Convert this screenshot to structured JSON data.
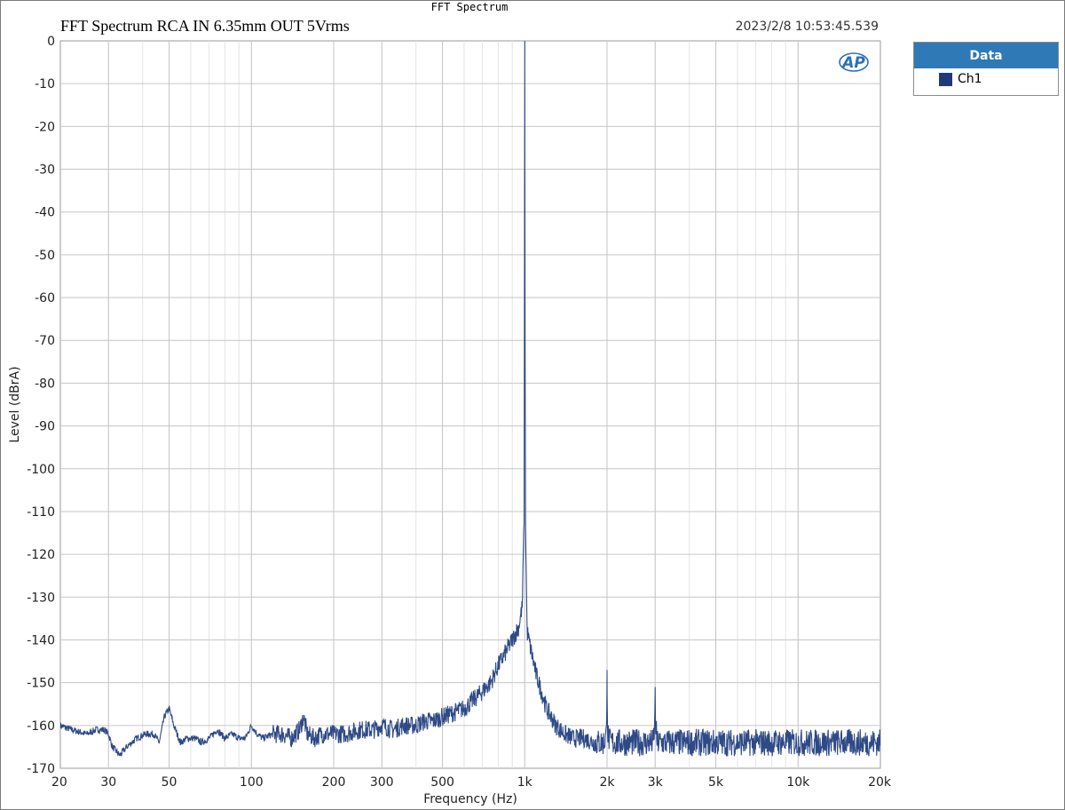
{
  "window_title": "FFT Spectrum",
  "plot_title": "FFT Spectrum RCA IN 6.35mm OUT 5Vrms",
  "timestamp": "2023/2/8 10:53:45.539",
  "logo_text": "AP",
  "legend": {
    "header": "Data",
    "items": [
      {
        "label": "Ch1",
        "color": "#1f3a78"
      }
    ]
  },
  "chart_data": {
    "type": "line",
    "xlabel": "Frequency (Hz)",
    "ylabel": "Level (dBrA)",
    "xscale": "log",
    "xlim": [
      20,
      20000
    ],
    "ylim": [
      -170,
      0
    ],
    "grid": true,
    "legend_position": "right, outside plot",
    "x_ticks": [
      {
        "value": 20,
        "label": "20"
      },
      {
        "value": 30,
        "label": "30"
      },
      {
        "value": 50,
        "label": "50"
      },
      {
        "value": 100,
        "label": "100"
      },
      {
        "value": 200,
        "label": "200"
      },
      {
        "value": 300,
        "label": "300"
      },
      {
        "value": 500,
        "label": "500"
      },
      {
        "value": 1000,
        "label": "1k"
      },
      {
        "value": 2000,
        "label": "2k"
      },
      {
        "value": 3000,
        "label": "3k"
      },
      {
        "value": 5000,
        "label": "5k"
      },
      {
        "value": 10000,
        "label": "10k"
      },
      {
        "value": 20000,
        "label": "20k"
      }
    ],
    "y_ticks": [
      0,
      -10,
      -20,
      -30,
      -40,
      -50,
      -60,
      -70,
      -80,
      -90,
      -100,
      -110,
      -120,
      -130,
      -140,
      -150,
      -160,
      -170
    ],
    "series": [
      {
        "name": "Ch1",
        "color": "#2e4a86",
        "x": [
          20,
          22,
          25,
          27,
          29,
          30,
          31,
          33,
          35,
          38,
          41,
          44,
          46,
          48,
          50,
          52,
          55,
          58,
          62,
          66,
          70,
          75,
          80,
          85,
          90,
          95,
          100,
          105,
          110,
          120,
          130,
          140,
          150,
          155,
          160,
          170,
          180,
          190,
          200,
          220,
          250,
          280,
          300,
          330,
          360,
          400,
          430,
          460,
          500,
          550,
          600,
          650,
          700,
          750,
          800,
          850,
          900,
          950,
          980,
          995,
          1000,
          1005,
          1020,
          1050,
          1100,
          1150,
          1200,
          1300,
          1400,
          1500,
          1650,
          1800,
          1950,
          1990,
          2000,
          2010,
          2050,
          2200,
          2500,
          2800,
          2950,
          2990,
          3000,
          3010,
          3050,
          3300,
          3700,
          4200,
          5000,
          6000,
          7000,
          8500,
          10000,
          12000,
          14000,
          16000,
          18000,
          20000
        ],
        "y": [
          -160,
          -161,
          -162,
          -161,
          -161,
          -162,
          -165,
          -167,
          -165,
          -163,
          -162,
          -162,
          -164,
          -158,
          -156,
          -160,
          -164,
          -163,
          -163,
          -164,
          -163,
          -161,
          -163,
          -162,
          -163,
          -163,
          -160,
          -162,
          -163,
          -162,
          -162,
          -163,
          -161,
          -158,
          -162,
          -163,
          -162,
          -162,
          -162,
          -162,
          -161,
          -161,
          -160,
          -161,
          -160,
          -160,
          -159,
          -159,
          -158,
          -157,
          -156,
          -154,
          -152,
          -150,
          -146,
          -143,
          -140,
          -137,
          -132,
          -110,
          0,
          -110,
          -138,
          -142,
          -148,
          -152,
          -156,
          -160,
          -162,
          -163,
          -163,
          -164,
          -164,
          -162,
          -147,
          -162,
          -164,
          -164,
          -164,
          -164,
          -164,
          -160,
          -151,
          -160,
          -164,
          -164,
          -164,
          -164,
          -164,
          -164,
          -164,
          -164,
          -164,
          -164,
          -164,
          -164,
          -164,
          -164
        ]
      }
    ]
  }
}
